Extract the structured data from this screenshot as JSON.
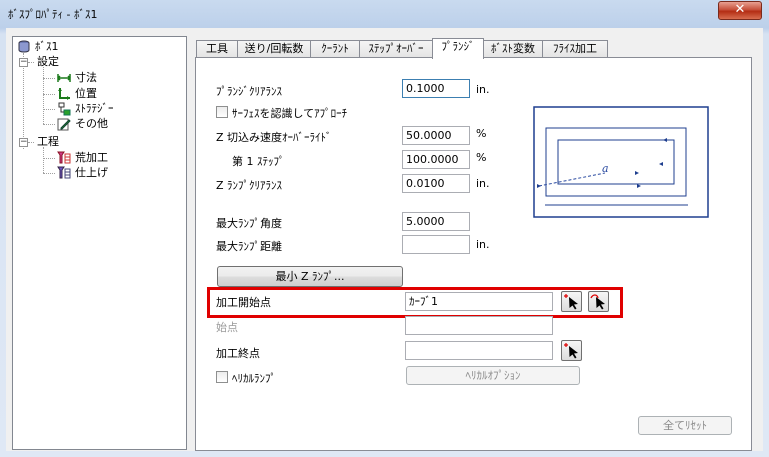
{
  "window": {
    "title": "ﾎﾞｽﾌﾟﾛﾊﾟﾃｨ - ﾎﾞｽ1",
    "close_label": "✕"
  },
  "tree": {
    "root": "ﾎﾞｽ1",
    "settings": "設定",
    "settings_items": [
      "寸法",
      "位置",
      "ｽﾄﾗﾃｼﾞｰ",
      "その他"
    ],
    "process": "工程",
    "process_items": [
      "荒加工",
      "仕上げ"
    ]
  },
  "tabs": [
    "工具",
    "送り/回転数",
    "ｸｰﾗﾝﾄ",
    "ｽﾃｯﾌﾟｵｰﾊﾞｰ",
    "ﾌﾟﾗﾝｼﾞ",
    "ﾎﾞｽﾄ変数",
    "ﾌﾗｲｽ加工"
  ],
  "active_tab": "ﾌﾟﾗﾝｼﾞ",
  "form": {
    "plunge_clearance": {
      "label": "ﾌﾟﾗﾝｼﾞｸﾘｱﾗﾝｽ",
      "value": "0.1000",
      "unit": "in."
    },
    "surface_approach": {
      "label": "ｻｰﾌｪｽを認識してｱﾌﾟﾛｰﾁ",
      "checked": false
    },
    "z_feed_override": {
      "label": "Z 切込み速度ｵｰﾊﾞｰﾗｲﾄﾞ",
      "value": "50.0000",
      "unit": "%"
    },
    "first_step": {
      "label": "第 1 ｽﾃｯﾌﾟ",
      "value": "100.0000",
      "unit": "%"
    },
    "z_ramp_clearance": {
      "label": "Z ﾗﾝﾌﾟｸﾘｱﾗﾝｽ",
      "value": "0.0100",
      "unit": "in."
    },
    "max_ramp_angle": {
      "label": "最大ﾗﾝﾌﾟ角度",
      "value": "5.0000"
    },
    "max_ramp_distance": {
      "label": "最大ﾗﾝﾌﾟ距離",
      "value": "",
      "unit": "in."
    },
    "min_z_ramp_button": "最小 Z ﾗﾝﾌﾟ...",
    "start_point": {
      "label": "加工開始点",
      "value": "ｶｰﾌﾞ1"
    },
    "begin_point": {
      "label": "始点",
      "value": ""
    },
    "end_point": {
      "label": "加工終点",
      "value": ""
    },
    "helical_ramp": {
      "label": "ﾍﾘｶﾙﾗﾝﾌﾟ",
      "checked": false
    },
    "helical_options_button": "ﾍﾘｶﾙｵﾌﾟｼｮﾝ",
    "reset_all_button": "全てﾘｾｯﾄ"
  },
  "diagram": {
    "label": "a"
  },
  "colors": {
    "highlight": "#e00000",
    "diagram_frame": "#1f3f8f",
    "ramp_line": "#2a4aa0"
  }
}
